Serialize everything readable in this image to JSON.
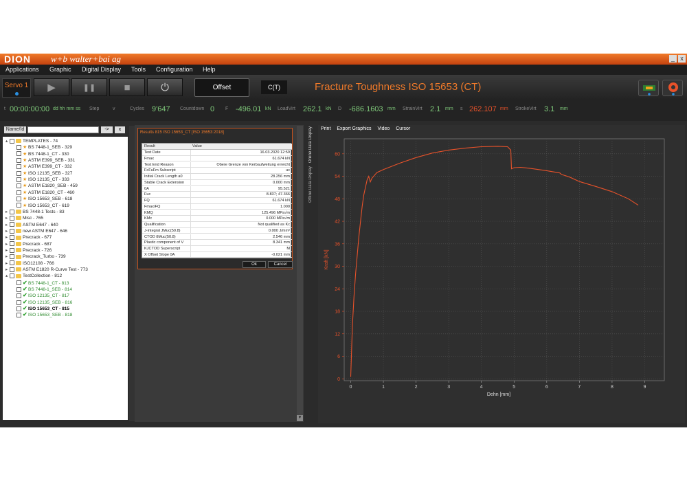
{
  "app": {
    "logo": "DION",
    "company": "w+b  walter+bai ag"
  },
  "window_buttons": [
    "_",
    "x"
  ],
  "menu": [
    "Applications",
    "Graphic",
    "Digital Display",
    "Tools",
    "Configuration",
    "Help"
  ],
  "toolbar": {
    "servo_label": "Servo 1",
    "offset_label": "Offset",
    "mode_label": "C(T)",
    "title": "Fracture Toughness ISO 15653 (CT)",
    "play_icon": "▶",
    "pause_icon": "❚❚",
    "stop_icon": "■",
    "power_icon": "⏻"
  },
  "status": {
    "t_label": "t",
    "time_value": "00:00:00:00",
    "time_unit": "dd hh mm ss",
    "step_label": "Step",
    "step_value": "v",
    "cycles_label": "Cycles",
    "cycles_value": "9'647",
    "countdown_label": "Countdown",
    "countdown_value": "0",
    "f_label": "F",
    "f_value": "-496.01",
    "f_unit": "kN",
    "loadvirt_label": "LoadVirt",
    "loadvirt_value": "262.1",
    "loadvirt_unit": "kN",
    "d_label": "D",
    "d_value": "-686.1603",
    "d_unit": "mm",
    "strainvirt_label": "StrainVirt",
    "strainvirt_value": "2.1",
    "strainvirt_unit": "mm",
    "s_label": "s",
    "s_value": "262.107",
    "s_unit": "mm",
    "strokevirt_label": "StrokeVirt",
    "strokevirt_value": "3.1",
    "strokevirt_unit": "mm"
  },
  "search": {
    "label": "Name/Id",
    "go": "->",
    "clear": "x"
  },
  "tree": [
    {
      "text": "TEMPLATES - 74",
      "level": 0,
      "icon": "folder",
      "expand": "▴"
    },
    {
      "text": "BS 7448-1_SEB - 329",
      "level": 1,
      "icon": "star"
    },
    {
      "text": "BS 7448-1_CT - 330",
      "level": 1,
      "icon": "star"
    },
    {
      "text": "ASTM E399_SEB - 331",
      "level": 1,
      "icon": "star"
    },
    {
      "text": "ASTM E399_CT - 332",
      "level": 1,
      "icon": "star"
    },
    {
      "text": "ISO 12135_SEB - 327",
      "level": 1,
      "icon": "star"
    },
    {
      "text": "ISO 12135_CT - 333",
      "level": 1,
      "icon": "star"
    },
    {
      "text": "ASTM E1820_SEB - 459",
      "level": 1,
      "icon": "star"
    },
    {
      "text": "ASTM E1820_CT - 460",
      "level": 1,
      "icon": "star"
    },
    {
      "text": "ISO 15653_SEB - 618",
      "level": 1,
      "icon": "star"
    },
    {
      "text": "ISO 15653_CT - 619",
      "level": 1,
      "icon": "star"
    },
    {
      "text": "BS 7448-1 Tests - 83",
      "level": 0,
      "icon": "folder",
      "expand": "▸"
    },
    {
      "text": "Misc - 765",
      "level": 0,
      "icon": "folder",
      "expand": "▸"
    },
    {
      "text": "ASTM E647 - 640",
      "level": 0,
      "icon": "folder",
      "expand": "▸"
    },
    {
      "text": "new ASTM E647 - 646",
      "level": 0,
      "icon": "folder",
      "expand": "▸"
    },
    {
      "text": "Precrack - 677",
      "level": 0,
      "icon": "folder",
      "expand": "▸"
    },
    {
      "text": "Precrack - 687",
      "level": 0,
      "icon": "folder",
      "expand": "▸"
    },
    {
      "text": "Precrack - 726",
      "level": 0,
      "icon": "folder",
      "expand": "▸"
    },
    {
      "text": "Precrack_Turbo - 739",
      "level": 0,
      "icon": "folder",
      "expand": "▸"
    },
    {
      "text": "ISO12108 - 766",
      "level": 0,
      "icon": "folder",
      "expand": "▸"
    },
    {
      "text": "ASTM E1820 R-Curve Test - 773",
      "level": 0,
      "icon": "folder",
      "expand": "▸"
    },
    {
      "text": "TestCollection - 812",
      "level": 0,
      "icon": "folder",
      "expand": "▴"
    },
    {
      "text": "BS 7448-1_CT - 813",
      "level": 1,
      "icon": "check",
      "style": "green"
    },
    {
      "text": "BS 7448-1_SEB - 814",
      "level": 1,
      "icon": "check",
      "style": "green"
    },
    {
      "text": "ISO 12135_CT - 817",
      "level": 1,
      "icon": "check",
      "style": "green"
    },
    {
      "text": "ISO 12135_SEB - 816",
      "level": 1,
      "icon": "check",
      "style": "green"
    },
    {
      "text": "ISO 15653_CT - 815",
      "level": 1,
      "icon": "check",
      "style": "bold"
    },
    {
      "text": "ISO 15653_SEB - 818",
      "level": 1,
      "icon": "check",
      "style": "green"
    }
  ],
  "results_dialog": {
    "title": "Results 815 ISO 15653_CT [ISO 15653:2018]",
    "col_result": "Result",
    "col_value": "Value",
    "rows": [
      {
        "label": "Test Date",
        "value": "16.03.2020 12:59"
      },
      {
        "label": "Fmax",
        "value": "61.674 kN"
      },
      {
        "label": "Test End Reason",
        "value": "Obere Grenze von Kerbaufweitung erreicht"
      },
      {
        "label": "FcFuFm Subscript",
        "value": "uc"
      },
      {
        "label": "Initial Crack Length a0",
        "value": "28.256 mm"
      },
      {
        "label": "Stable Crack Extension",
        "value": "0.000 mm"
      },
      {
        "label": "0A",
        "value": "95.521"
      },
      {
        "label": "Fuc",
        "value": "8.837; 47.366"
      },
      {
        "label": "FQ",
        "value": "61.674 kN"
      },
      {
        "label": "Fmax/FQ",
        "value": "1.000"
      },
      {
        "label": "KMQ",
        "value": "125.496 MPa√m"
      },
      {
        "label": "KMc",
        "value": "0.000 MPa√m"
      },
      {
        "label": "Qualification",
        "value": "Not qualified as Kc"
      },
      {
        "label": "J-integral JMuc(50.8)",
        "value": "0.000 J/mm²"
      },
      {
        "label": "CTOD δMuc(50.8)",
        "value": "2.546 mm"
      },
      {
        "label": "Plastic component of V",
        "value": "8.341 mm"
      },
      {
        "label": "KJCTOD Superscript",
        "value": "M"
      },
      {
        "label": "X Offset Slope 0A",
        "value": "-0.021 mm"
      }
    ],
    "ok": "Ok",
    "cancel": "Cancel"
  },
  "side_tabs": [
    "Online Data Display",
    "Offline Data Display"
  ],
  "chart_menu": [
    "Print",
    "Export Graphics",
    "Video",
    "Cursor"
  ],
  "chart_data": {
    "type": "line",
    "xlabel": "Dehn [mm]",
    "ylabel": "Kraft [kN]",
    "xlim": [
      -0.2,
      9.6
    ],
    "ylim": [
      -0.5,
      64
    ],
    "xticks": [
      0,
      1,
      2,
      3,
      4,
      5,
      6,
      7,
      8,
      9
    ],
    "yticks": [
      0,
      6,
      12,
      18,
      24,
      30,
      36,
      42,
      48,
      54,
      60
    ],
    "grid": true,
    "line_color": "#e8522a",
    "series": [
      {
        "x": [
          0.0,
          0.02,
          0.05,
          0.1,
          0.15,
          0.2,
          0.25,
          0.3,
          0.35,
          0.4,
          0.45,
          0.5,
          0.55,
          0.6,
          0.65,
          0.7,
          0.75,
          0.8,
          1.0,
          1.5,
          2.0,
          2.5,
          3.0,
          3.5,
          4.0,
          4.5,
          4.8,
          4.9,
          4.92,
          5.0,
          5.2,
          5.5,
          6.0,
          6.4,
          6.45,
          6.7,
          7.0,
          7.5,
          8.0,
          8.5,
          8.8
        ],
        "y": [
          0.5,
          6,
          14,
          22,
          28,
          33,
          38,
          42,
          46,
          49,
          51,
          53,
          54,
          52.5,
          53.5,
          54,
          54.5,
          55,
          55.8,
          57.5,
          59,
          60.2,
          61,
          61.5,
          61.9,
          62.0,
          61.9,
          61.0,
          56,
          56.3,
          56.4,
          56.1,
          55.5,
          54.9,
          54.5,
          53.8,
          52.6,
          51.3,
          49.9,
          48.0,
          46.3
        ]
      }
    ]
  }
}
